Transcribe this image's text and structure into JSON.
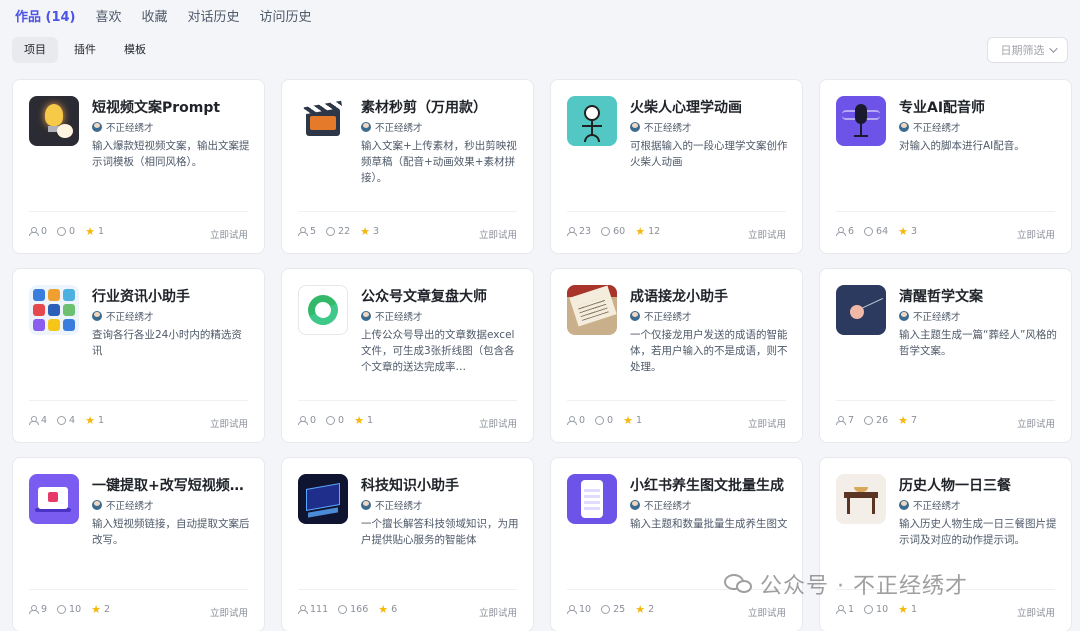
{
  "top_tabs": [
    {
      "label": "作品 (14)",
      "active": true
    },
    {
      "label": "喜欢"
    },
    {
      "label": "收藏"
    },
    {
      "label": "对话历史"
    },
    {
      "label": "访问历史"
    }
  ],
  "sub_tabs": [
    {
      "label": "项目",
      "active": true
    },
    {
      "label": "插件"
    },
    {
      "label": "模板"
    }
  ],
  "filter": {
    "label": "日期筛选"
  },
  "try_label": "立即试用",
  "cards": [
    {
      "title": "短视频文案Prompt",
      "author": "不正经绣才",
      "desc": "输入爆款短视频文案，输出文案提示词模板（相同风格）。",
      "users": "0",
      "chats": "0",
      "stars": "1",
      "icon": "lightbulb-icon"
    },
    {
      "title": "素材秒剪（万用款）",
      "author": "不正经绣才",
      "desc": "输入文案+上传素材，秒出剪映视频草稿（配音+动画效果+素材拼接）。",
      "users": "5",
      "chats": "22",
      "stars": "3",
      "icon": "clapperboard-icon"
    },
    {
      "title": "火柴人心理学动画",
      "author": "不正经绣才",
      "desc": "可根据输入的一段心理学文案创作火柴人动画",
      "users": "23",
      "chats": "60",
      "stars": "12",
      "icon": "stickman-icon"
    },
    {
      "title": "专业AI配音师",
      "author": "不正经绣才",
      "desc": "对输入的脚本进行AI配音。",
      "users": "6",
      "chats": "64",
      "stars": "3",
      "icon": "microphone-icon"
    },
    {
      "title": "行业资讯小助手",
      "author": "不正经绣才",
      "desc": "查询各行各业24小时内的精选资讯",
      "users": "4",
      "chats": "4",
      "stars": "1",
      "icon": "news-collage-icon"
    },
    {
      "title": "公众号文章复盘大师",
      "author": "不正经绣才",
      "desc": "上传公众号导出的文章数据excel文件，可生成3张折线图（包含各个文章的送达完成率…",
      "users": "0",
      "chats": "0",
      "stars": "1",
      "icon": "wechat-circle-icon"
    },
    {
      "title": "成语接龙小助手",
      "author": "不正经绣才",
      "desc": "一个仅接龙用户发送的成语的智能体，若用户输入的不是成语，则不处理。",
      "users": "0",
      "chats": "0",
      "stars": "1",
      "icon": "book-icon"
    },
    {
      "title": "清醒哲学文案",
      "author": "不正经绣才",
      "desc": "输入主题生成一篇“葬经人”风格的哲学文案。",
      "users": "7",
      "chats": "26",
      "stars": "7",
      "icon": "moon-icon"
    },
    {
      "title": "一键提取+改写短视频…",
      "author": "不正经绣才",
      "desc": "输入短视频链接，自动提取文案后改写。",
      "users": "9",
      "chats": "10",
      "stars": "2",
      "icon": "video-screen-icon"
    },
    {
      "title": "科技知识小助手",
      "author": "不正经绣才",
      "desc": "一个擅长解答科技领域知识，为用户提供贴心服务的智能体",
      "users": "111",
      "chats": "166",
      "stars": "6",
      "icon": "computer-icon"
    },
    {
      "title": "小红书养生图文批量生成",
      "author": "不正经绣才",
      "desc": "输入主题和数量批量生成养生图文",
      "users": "10",
      "chats": "25",
      "stars": "2",
      "icon": "phone-icon"
    },
    {
      "title": "历史人物一日三餐",
      "author": "不正经绣才",
      "desc": "输入历史人物生成一日三餐图片提示词及对应的动作提示词。",
      "users": "1",
      "chats": "10",
      "stars": "1",
      "icon": "table-icon"
    }
  ],
  "watermark": "公众号 · 不正经绣才"
}
